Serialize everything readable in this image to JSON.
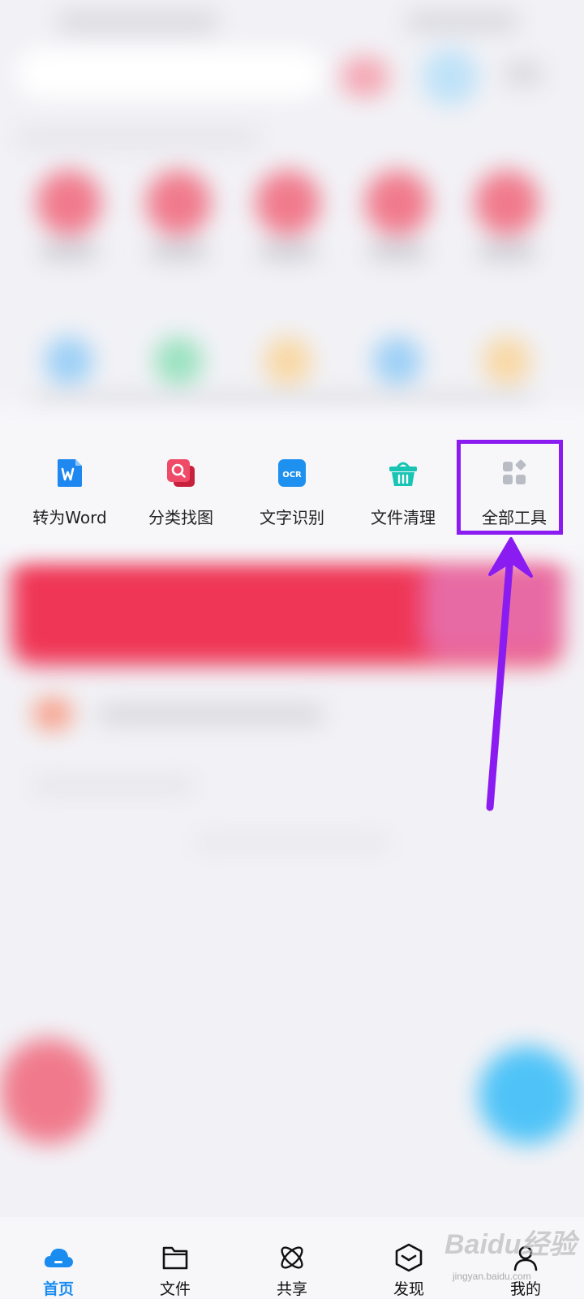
{
  "tools": [
    {
      "label": "转为Word",
      "icon": "word-doc-icon",
      "color": "#1e88f0"
    },
    {
      "label": "分类找图",
      "icon": "image-search-icon",
      "color": "#ef4b69"
    },
    {
      "label": "文字识别",
      "icon": "ocr-icon",
      "color": "#1e90f0",
      "icon_text": "OCR"
    },
    {
      "label": "文件清理",
      "icon": "cleanup-basket-icon",
      "color": "#18c4b4"
    },
    {
      "label": "全部工具",
      "icon": "all-tools-grid-icon",
      "color": "#b9bcc4"
    }
  ],
  "highlight_color": "#8a1cf2",
  "bottom_nav": [
    {
      "label": "首页",
      "icon": "home-cloud-icon",
      "active": true
    },
    {
      "label": "文件",
      "icon": "folder-icon",
      "active": false
    },
    {
      "label": "共享",
      "icon": "share-atom-icon",
      "active": false
    },
    {
      "label": "发现",
      "icon": "discover-cube-icon",
      "active": false
    },
    {
      "label": "我的",
      "icon": "profile-icon",
      "active": false
    }
  ],
  "accent_color": "#1a8cf0",
  "watermark": {
    "text": "Baidu经验",
    "sub": "jingyan.baidu.com"
  }
}
